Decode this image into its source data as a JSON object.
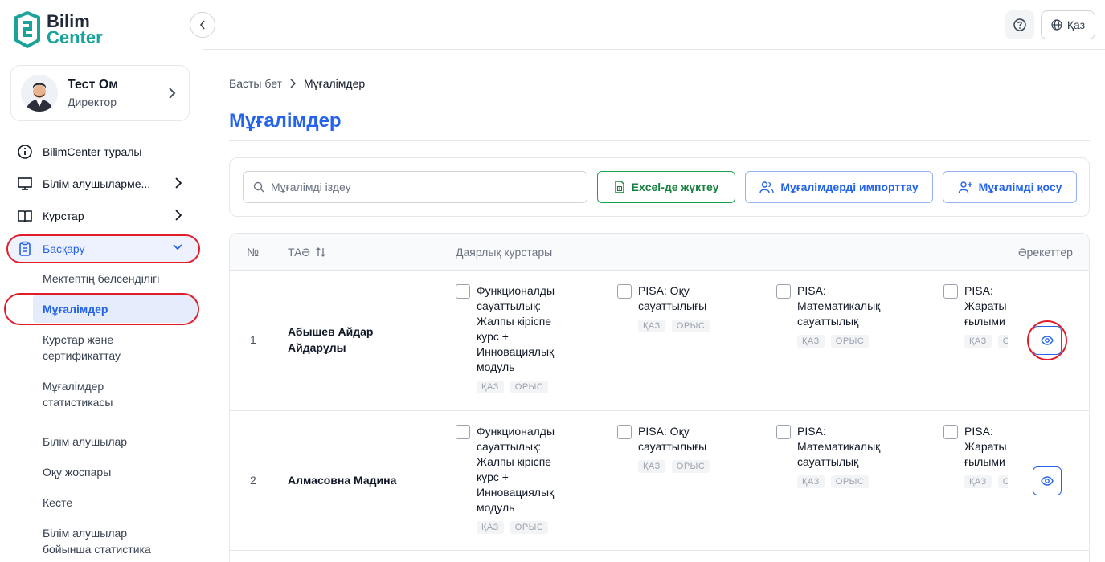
{
  "brand": {
    "line1": "Bilim",
    "line2": "Center"
  },
  "profile": {
    "name": "Тест Ом",
    "role": "Директор"
  },
  "nav": {
    "about": "BilimCenter туралы",
    "learners": "Білім алушыларме...",
    "courses": "Курстар",
    "manage": "Басқару"
  },
  "subnav": {
    "activity": "Мектептің белсенділігі",
    "teachers": "Мұғалімдер",
    "courses_cert_1": "Курстар және",
    "courses_cert_2": "сертификаттау",
    "teacher_stats_1": "Мұғалімдер",
    "teacher_stats_2": "статистикасы",
    "learners": "Білім алушылар",
    "plan": "Оқу жоспары",
    "schedule": "Кесте",
    "learner_stats_1": "Білім алушылар",
    "learner_stats_2": "бойынша статистика"
  },
  "header": {
    "lang": "Қаз"
  },
  "breadcrumb": {
    "home": "Басты бет",
    "current": "Мұғалімдер"
  },
  "page": {
    "title": "Мұғалімдер"
  },
  "toolbar": {
    "search_placeholder": "Мұғалімді іздеу",
    "excel": "Excel-де жүктеу",
    "import": "Мұғалімдерді импорттау",
    "add": "Мұғалімді қосу"
  },
  "table": {
    "headers": {
      "num": "№",
      "name": "ТАӘ",
      "courses": "Даярлық курстары",
      "actions": "Әрекеттер"
    },
    "courses": {
      "c1": [
        "Функционалды",
        "сауаттылық:",
        "Жалпы кіріспе",
        "курс +",
        "Инновациялық",
        "модуль"
      ],
      "c2": [
        "PISA: Оқу",
        "сауаттылығы"
      ],
      "c3": [
        "PISA:",
        "Математикалық",
        "сауаттылық"
      ],
      "c4": [
        "PISA:",
        "Жараты",
        "ғылыми"
      ]
    },
    "tags": {
      "kz": "ҚАЗ",
      "ru": "ОРЫС"
    },
    "rows": [
      {
        "num": "1",
        "name_1": "Абышев Айдар",
        "name_2": "Айдарұлы"
      },
      {
        "num": "2",
        "name_1": "Алмасовна Мадина",
        "name_2": ""
      }
    ]
  },
  "colors": {
    "accent": "#2563eb",
    "success": "#16a34a",
    "highlight": "#e11d2a",
    "brand_teal": "#1aa39a"
  }
}
